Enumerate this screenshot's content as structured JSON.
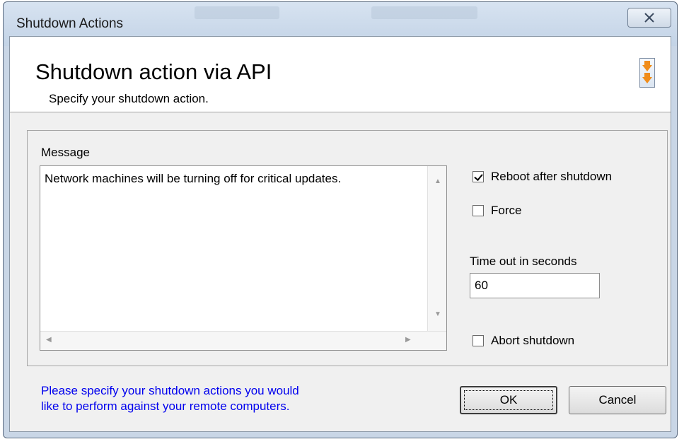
{
  "window": {
    "title": "Shutdown Actions",
    "close_glyph": "☒"
  },
  "header": {
    "title": "Shutdown action via API",
    "subtitle": "Specify your shutdown action.",
    "icon": "action-order-icon"
  },
  "message": {
    "label": "Message",
    "value": "Network machines will be turning off for critical updates."
  },
  "options": {
    "reboot": {
      "label": "Reboot after shutdown",
      "checked": true
    },
    "force": {
      "label": "Force",
      "checked": false
    },
    "timeout_label": "Time out in seconds",
    "timeout_value": "60",
    "abort": {
      "label": "Abort shutdown",
      "checked": false
    }
  },
  "footer": {
    "info_line1": "Please specify your shutdown actions you would",
    "info_line2": "like to perform against your remote computers.",
    "ok_label": "OK",
    "cancel_label": "Cancel"
  },
  "colors": {
    "info_text": "#0000ee",
    "accent_icon": "#f08c1a"
  }
}
